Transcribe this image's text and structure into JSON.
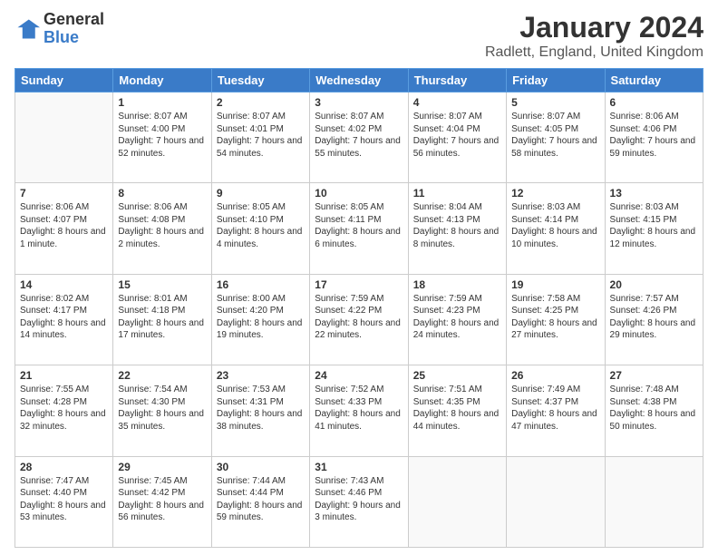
{
  "header": {
    "logo_general": "General",
    "logo_blue": "Blue",
    "month_title": "January 2024",
    "location": "Radlett, England, United Kingdom"
  },
  "days_of_week": [
    "Sunday",
    "Monday",
    "Tuesday",
    "Wednesday",
    "Thursday",
    "Friday",
    "Saturday"
  ],
  "weeks": [
    [
      {
        "day": "",
        "empty": true
      },
      {
        "day": "1",
        "sunrise": "Sunrise: 8:07 AM",
        "sunset": "Sunset: 4:00 PM",
        "daylight": "Daylight: 7 hours and 52 minutes."
      },
      {
        "day": "2",
        "sunrise": "Sunrise: 8:07 AM",
        "sunset": "Sunset: 4:01 PM",
        "daylight": "Daylight: 7 hours and 54 minutes."
      },
      {
        "day": "3",
        "sunrise": "Sunrise: 8:07 AM",
        "sunset": "Sunset: 4:02 PM",
        "daylight": "Daylight: 7 hours and 55 minutes."
      },
      {
        "day": "4",
        "sunrise": "Sunrise: 8:07 AM",
        "sunset": "Sunset: 4:04 PM",
        "daylight": "Daylight: 7 hours and 56 minutes."
      },
      {
        "day": "5",
        "sunrise": "Sunrise: 8:07 AM",
        "sunset": "Sunset: 4:05 PM",
        "daylight": "Daylight: 7 hours and 58 minutes."
      },
      {
        "day": "6",
        "sunrise": "Sunrise: 8:06 AM",
        "sunset": "Sunset: 4:06 PM",
        "daylight": "Daylight: 7 hours and 59 minutes."
      }
    ],
    [
      {
        "day": "7",
        "sunrise": "Sunrise: 8:06 AM",
        "sunset": "Sunset: 4:07 PM",
        "daylight": "Daylight: 8 hours and 1 minute."
      },
      {
        "day": "8",
        "sunrise": "Sunrise: 8:06 AM",
        "sunset": "Sunset: 4:08 PM",
        "daylight": "Daylight: 8 hours and 2 minutes."
      },
      {
        "day": "9",
        "sunrise": "Sunrise: 8:05 AM",
        "sunset": "Sunset: 4:10 PM",
        "daylight": "Daylight: 8 hours and 4 minutes."
      },
      {
        "day": "10",
        "sunrise": "Sunrise: 8:05 AM",
        "sunset": "Sunset: 4:11 PM",
        "daylight": "Daylight: 8 hours and 6 minutes."
      },
      {
        "day": "11",
        "sunrise": "Sunrise: 8:04 AM",
        "sunset": "Sunset: 4:13 PM",
        "daylight": "Daylight: 8 hours and 8 minutes."
      },
      {
        "day": "12",
        "sunrise": "Sunrise: 8:03 AM",
        "sunset": "Sunset: 4:14 PM",
        "daylight": "Daylight: 8 hours and 10 minutes."
      },
      {
        "day": "13",
        "sunrise": "Sunrise: 8:03 AM",
        "sunset": "Sunset: 4:15 PM",
        "daylight": "Daylight: 8 hours and 12 minutes."
      }
    ],
    [
      {
        "day": "14",
        "sunrise": "Sunrise: 8:02 AM",
        "sunset": "Sunset: 4:17 PM",
        "daylight": "Daylight: 8 hours and 14 minutes."
      },
      {
        "day": "15",
        "sunrise": "Sunrise: 8:01 AM",
        "sunset": "Sunset: 4:18 PM",
        "daylight": "Daylight: 8 hours and 17 minutes."
      },
      {
        "day": "16",
        "sunrise": "Sunrise: 8:00 AM",
        "sunset": "Sunset: 4:20 PM",
        "daylight": "Daylight: 8 hours and 19 minutes."
      },
      {
        "day": "17",
        "sunrise": "Sunrise: 7:59 AM",
        "sunset": "Sunset: 4:22 PM",
        "daylight": "Daylight: 8 hours and 22 minutes."
      },
      {
        "day": "18",
        "sunrise": "Sunrise: 7:59 AM",
        "sunset": "Sunset: 4:23 PM",
        "daylight": "Daylight: 8 hours and 24 minutes."
      },
      {
        "day": "19",
        "sunrise": "Sunrise: 7:58 AM",
        "sunset": "Sunset: 4:25 PM",
        "daylight": "Daylight: 8 hours and 27 minutes."
      },
      {
        "day": "20",
        "sunrise": "Sunrise: 7:57 AM",
        "sunset": "Sunset: 4:26 PM",
        "daylight": "Daylight: 8 hours and 29 minutes."
      }
    ],
    [
      {
        "day": "21",
        "sunrise": "Sunrise: 7:55 AM",
        "sunset": "Sunset: 4:28 PM",
        "daylight": "Daylight: 8 hours and 32 minutes."
      },
      {
        "day": "22",
        "sunrise": "Sunrise: 7:54 AM",
        "sunset": "Sunset: 4:30 PM",
        "daylight": "Daylight: 8 hours and 35 minutes."
      },
      {
        "day": "23",
        "sunrise": "Sunrise: 7:53 AM",
        "sunset": "Sunset: 4:31 PM",
        "daylight": "Daylight: 8 hours and 38 minutes."
      },
      {
        "day": "24",
        "sunrise": "Sunrise: 7:52 AM",
        "sunset": "Sunset: 4:33 PM",
        "daylight": "Daylight: 8 hours and 41 minutes."
      },
      {
        "day": "25",
        "sunrise": "Sunrise: 7:51 AM",
        "sunset": "Sunset: 4:35 PM",
        "daylight": "Daylight: 8 hours and 44 minutes."
      },
      {
        "day": "26",
        "sunrise": "Sunrise: 7:49 AM",
        "sunset": "Sunset: 4:37 PM",
        "daylight": "Daylight: 8 hours and 47 minutes."
      },
      {
        "day": "27",
        "sunrise": "Sunrise: 7:48 AM",
        "sunset": "Sunset: 4:38 PM",
        "daylight": "Daylight: 8 hours and 50 minutes."
      }
    ],
    [
      {
        "day": "28",
        "sunrise": "Sunrise: 7:47 AM",
        "sunset": "Sunset: 4:40 PM",
        "daylight": "Daylight: 8 hours and 53 minutes."
      },
      {
        "day": "29",
        "sunrise": "Sunrise: 7:45 AM",
        "sunset": "Sunset: 4:42 PM",
        "daylight": "Daylight: 8 hours and 56 minutes."
      },
      {
        "day": "30",
        "sunrise": "Sunrise: 7:44 AM",
        "sunset": "Sunset: 4:44 PM",
        "daylight": "Daylight: 8 hours and 59 minutes."
      },
      {
        "day": "31",
        "sunrise": "Sunrise: 7:43 AM",
        "sunset": "Sunset: 4:46 PM",
        "daylight": "Daylight: 9 hours and 3 minutes."
      },
      {
        "day": "",
        "empty": true
      },
      {
        "day": "",
        "empty": true
      },
      {
        "day": "",
        "empty": true
      }
    ]
  ]
}
